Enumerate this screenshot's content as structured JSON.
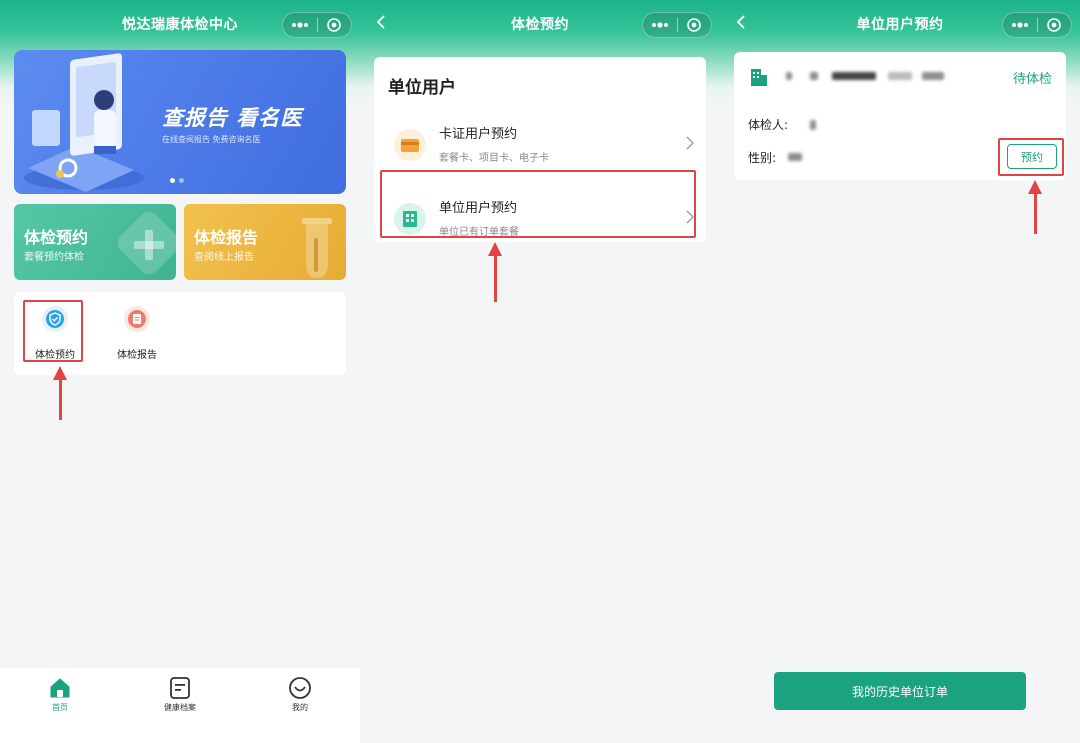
{
  "colors": {
    "brand_green": "#1aa37e",
    "banner_blue": "#4d7be8",
    "tile_yellow": "#e6ac33",
    "annotation_red": "#e24444"
  },
  "screen1": {
    "nav_title": "悦达瑞康体检中心",
    "banner": {
      "headline": "查报告 看名医",
      "subtitle": "在线查阅报告  免费咨询名医"
    },
    "tiles": [
      {
        "title": "体检预约",
        "subtitle": "套餐预约体检"
      },
      {
        "title": "体检报告",
        "subtitle": "查阅线上报告"
      }
    ],
    "quick_items": [
      {
        "label": "体检预约",
        "icon": "shield-check-icon"
      },
      {
        "label": "体检报告",
        "icon": "report-icon"
      }
    ],
    "tabbar": [
      {
        "label": "首页",
        "icon": "home-icon"
      },
      {
        "label": "健康档案",
        "icon": "document-icon"
      },
      {
        "label": "我的",
        "icon": "smile-icon"
      }
    ]
  },
  "screen2": {
    "nav_title": "体检预约",
    "section_title": "单位用户",
    "options": [
      {
        "title": "卡证用户预约",
        "subtitle": "套餐卡、项目卡、电子卡",
        "icon": "card-icon"
      },
      {
        "title": "单位用户预约",
        "subtitle": "单位已有订单套餐",
        "icon": "building-icon"
      }
    ]
  },
  "screen3": {
    "nav_title": "单位用户预约",
    "status": "待体检",
    "examinee_label": "体检人:",
    "gender_label": "性别:",
    "book_button": "预约",
    "history_button": "我的历史单位订单"
  }
}
